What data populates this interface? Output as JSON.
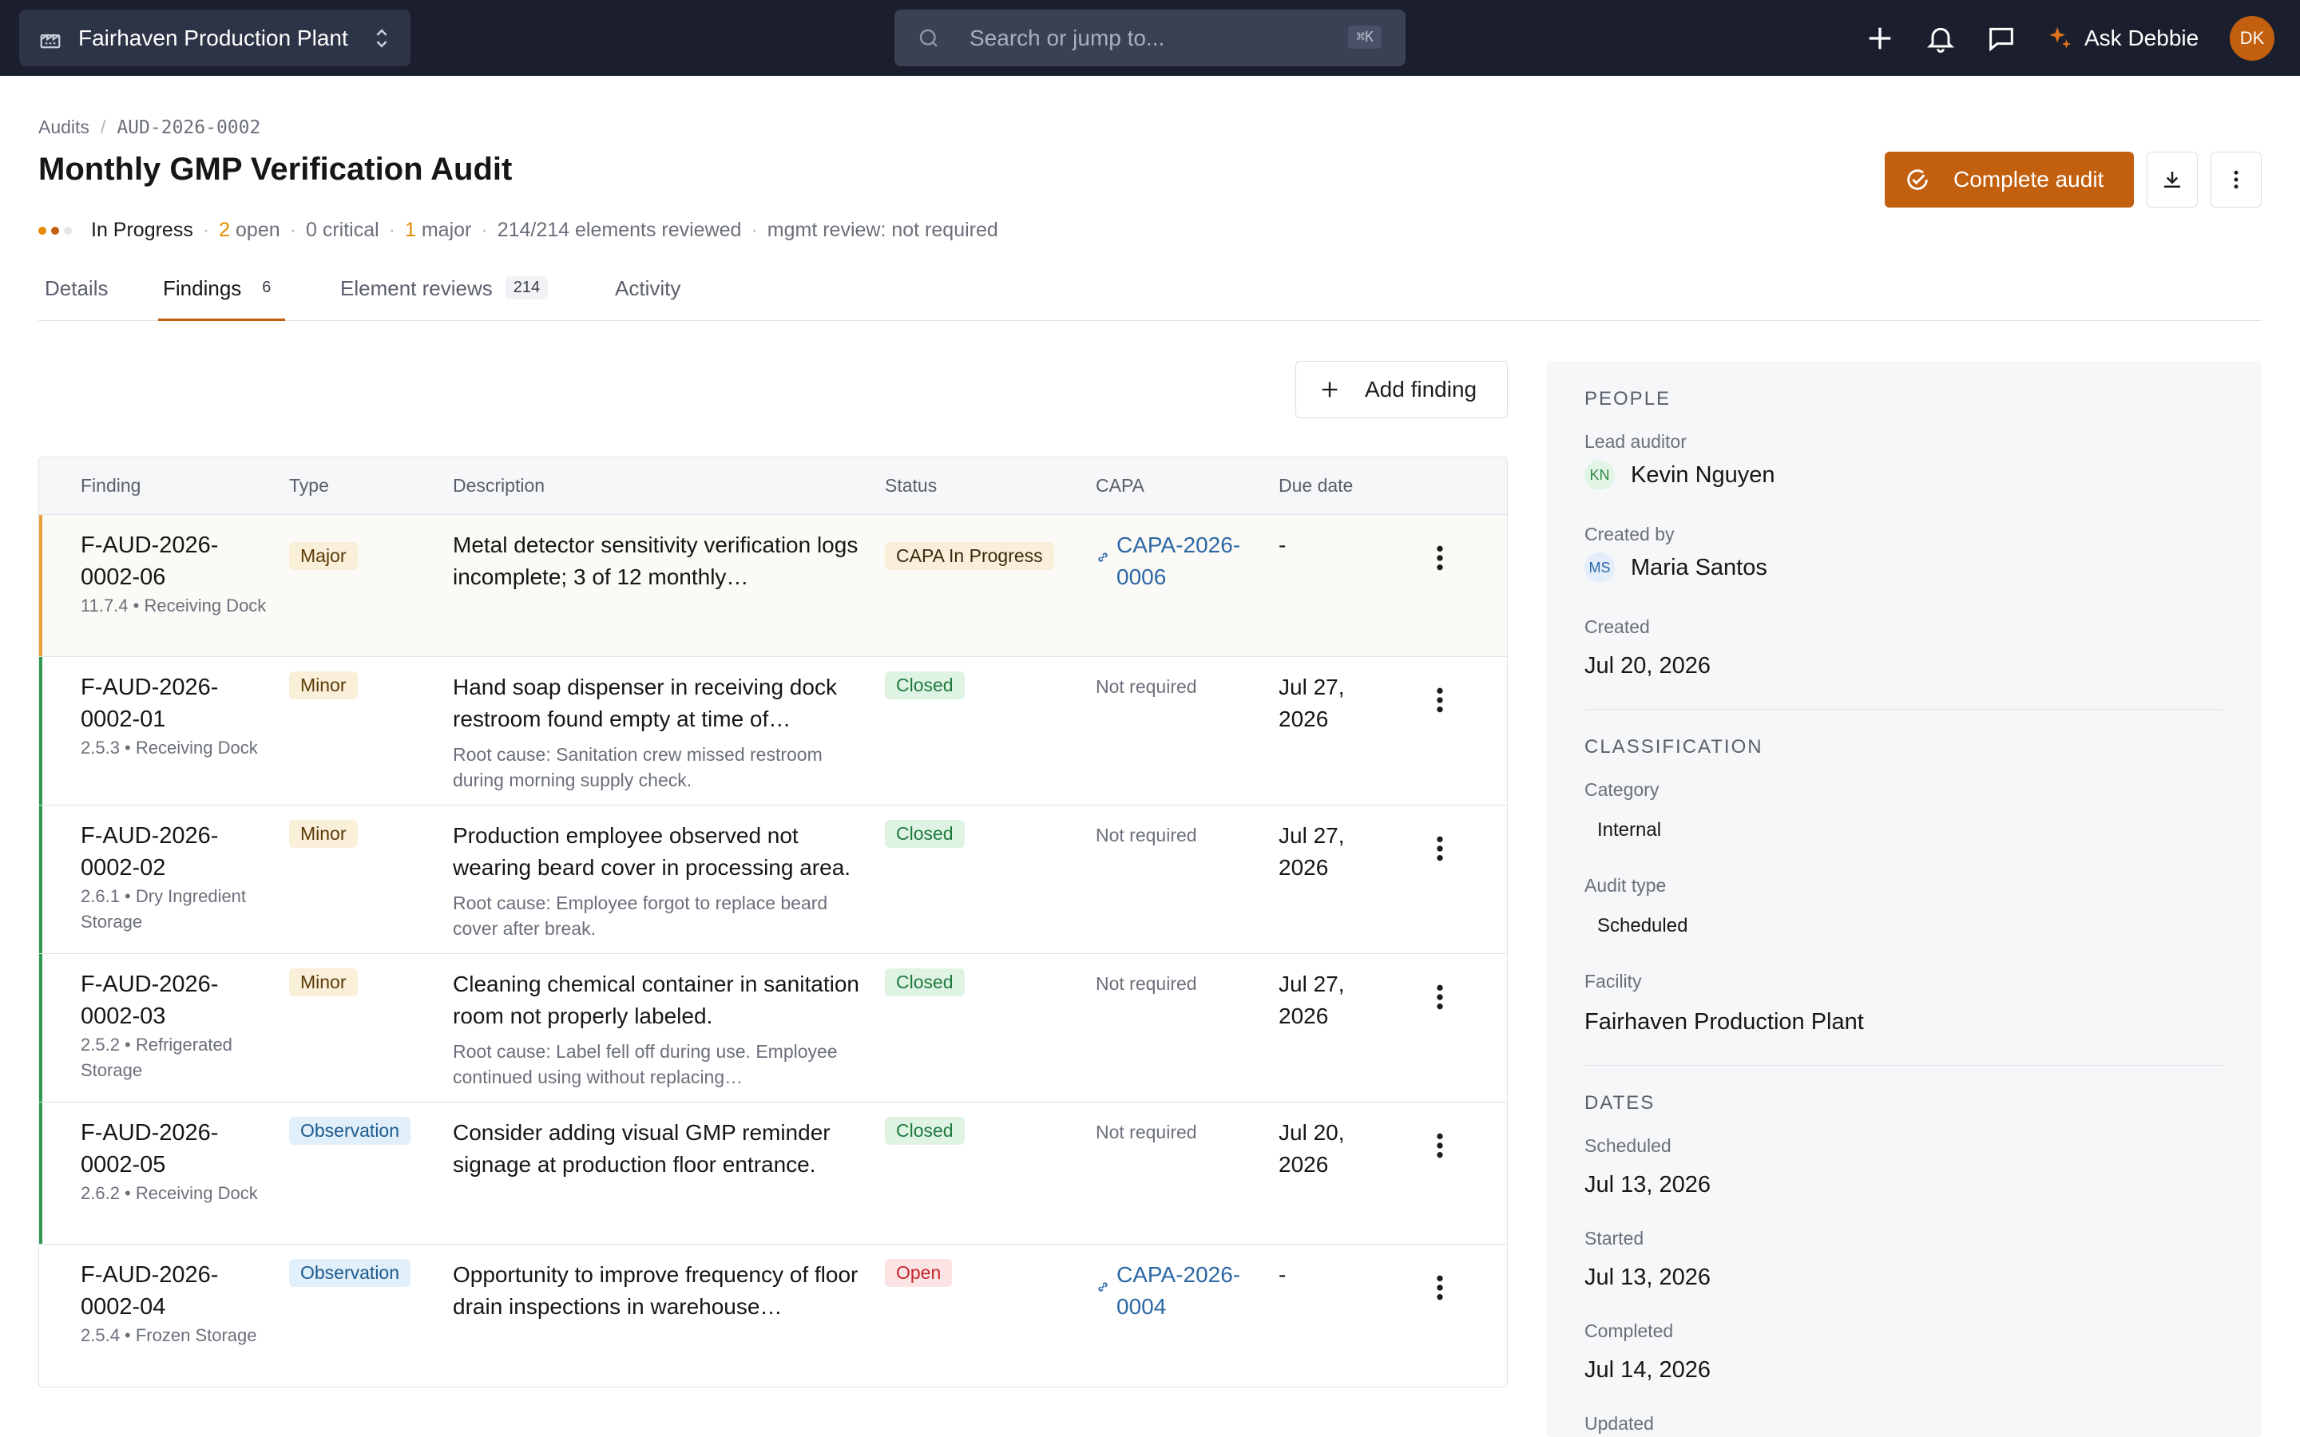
{
  "topbar": {
    "facility": "Fairhaven Production Plant",
    "search_placeholder": "Search or jump to...",
    "search_shortcut": "⌘K",
    "ask_label": "Ask Debbie",
    "avatar_initials": "DK"
  },
  "breadcrumb": [
    "Audits",
    "AUD-2026-0002"
  ],
  "page": {
    "title": "Monthly GMP Verification Audit",
    "status": "In Progress",
    "open_count": "2",
    "open_label": "open",
    "critical": "0 critical",
    "major_count": "1",
    "major_label": "major",
    "elements_reviewed": "214/214 elements reviewed",
    "mgmt_review": "mgmt review: not required"
  },
  "actions": {
    "complete_label": "Complete audit",
    "add_finding_label": "Add finding"
  },
  "tabs": [
    {
      "label": "Details",
      "count": ""
    },
    {
      "label": "Findings",
      "count": "6"
    },
    {
      "label": "Element reviews",
      "count": "214"
    },
    {
      "label": "Activity",
      "count": ""
    }
  ],
  "table": {
    "headers": [
      "Finding",
      "Type",
      "Description",
      "Status",
      "CAPA",
      "Due date"
    ],
    "rows": [
      {
        "id": "F-AUD-2026-0002-06",
        "location": "11.7.4 • Receiving Dock",
        "type": "Major",
        "description": "Metal detector sensitivity verification logs incomplete; 3 of 12 monthly…",
        "root_cause": "",
        "status": "CAPA In Progress",
        "capa": "CAPA-2026-0006",
        "due": "-"
      },
      {
        "id": "F-AUD-2026-0002-01",
        "location": "2.5.3 • Receiving Dock",
        "type": "Minor",
        "description": "Hand soap dispenser in receiving dock restroom found empty at time of…",
        "root_cause": "Root cause: Sanitation crew missed restroom during morning supply check.",
        "status": "Closed",
        "capa": "Not required",
        "due": "Jul 27, 2026"
      },
      {
        "id": "F-AUD-2026-0002-02",
        "location": "2.6.1 • Dry Ingredient Storage",
        "type": "Minor",
        "description": "Production employee observed not wearing beard cover in processing area.",
        "root_cause": "Root cause: Employee forgot to replace beard cover after break.",
        "status": "Closed",
        "capa": "Not required",
        "due": "Jul 27, 2026"
      },
      {
        "id": "F-AUD-2026-0002-03",
        "location": "2.5.2 • Refrigerated Storage",
        "type": "Minor",
        "description": "Cleaning chemical container in sanitation room not properly labeled.",
        "root_cause": "Root cause: Label fell off during use. Employee continued using without replacing…",
        "status": "Closed",
        "capa": "Not required",
        "due": "Jul 27, 2026"
      },
      {
        "id": "F-AUD-2026-0002-05",
        "location": "2.6.2 • Receiving Dock",
        "type": "Observation",
        "description": "Consider adding visual GMP reminder signage at production floor entrance.",
        "root_cause": "",
        "status": "Closed",
        "capa": "Not required",
        "due": "Jul 20, 2026"
      },
      {
        "id": "F-AUD-2026-0002-04",
        "location": "2.5.4 • Frozen Storage",
        "type": "Observation",
        "description": "Opportunity to improve frequency of floor drain inspections in warehouse…",
        "root_cause": "",
        "status": "Open",
        "capa": "CAPA-2026-0004",
        "due": "-"
      }
    ]
  },
  "panel": {
    "people_heading": "PEOPLE",
    "lead_auditor_label": "Lead auditor",
    "lead_auditor_initials": "KN",
    "lead_auditor": "Kevin Nguyen",
    "created_by_label": "Created by",
    "created_by_initials": "MS",
    "created_by": "Maria Santos",
    "created_label": "Created",
    "created": "Jul 20, 2026",
    "classification_heading": "CLASSIFICATION",
    "category_label": "Category",
    "category": "Internal",
    "audit_type_label": "Audit type",
    "audit_type": "Scheduled",
    "facility_label": "Facility",
    "facility": "Fairhaven Production Plant",
    "dates_heading": "DATES",
    "scheduled_label": "Scheduled",
    "scheduled": "Jul 13, 2026",
    "started_label": "Started",
    "started": "Jul 13, 2026",
    "completed_label": "Completed",
    "completed": "Jul 14, 2026",
    "updated_label": "Updated"
  },
  "colors": {
    "accent": "#c2600f",
    "topbar": "#1b1f2d",
    "major_row_accent": "#e8a13a",
    "closed_row_accent": "#2f9a4f"
  }
}
